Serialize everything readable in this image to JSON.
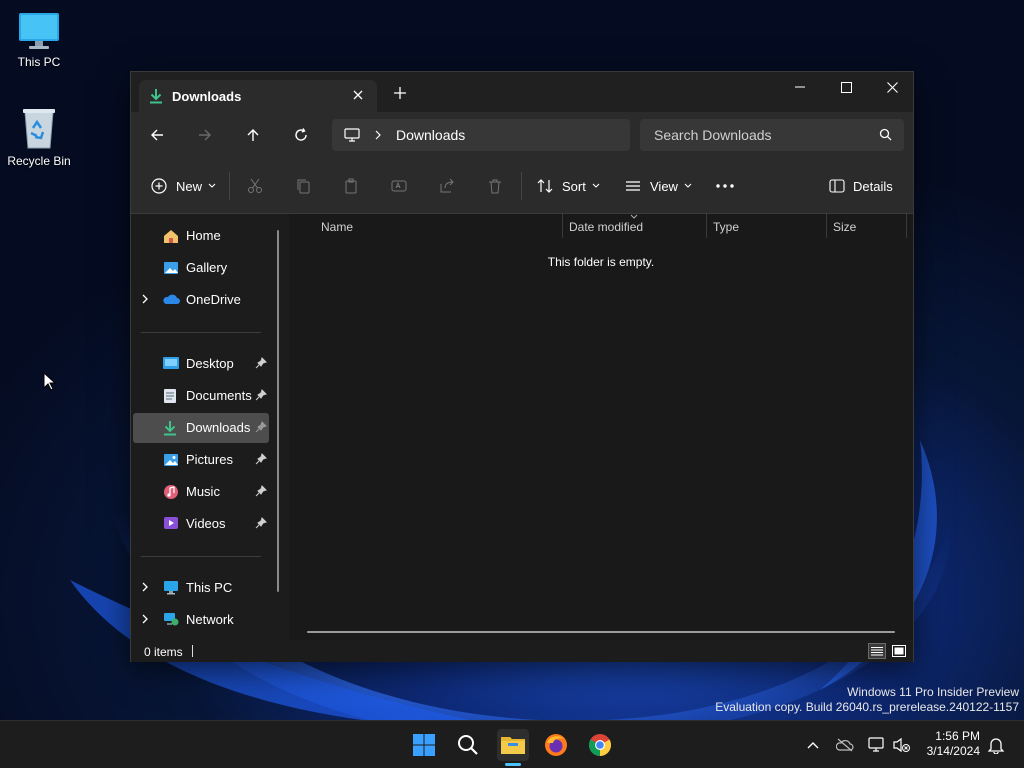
{
  "desktop": {
    "icons": [
      {
        "label": "This PC"
      },
      {
        "label": "Recycle Bin"
      }
    ]
  },
  "explorer": {
    "tab_title": "Downloads",
    "address": {
      "location": "Downloads"
    },
    "search": {
      "placeholder": "Search Downloads"
    },
    "toolbar": {
      "new_label": "New",
      "sort_label": "Sort",
      "view_label": "View",
      "details_label": "Details"
    },
    "nav": {
      "quick": [
        {
          "label": "Home"
        },
        {
          "label": "Gallery"
        },
        {
          "label": "OneDrive"
        }
      ],
      "pinned": [
        {
          "label": "Desktop"
        },
        {
          "label": "Documents"
        },
        {
          "label": "Downloads"
        },
        {
          "label": "Pictures"
        },
        {
          "label": "Music"
        },
        {
          "label": "Videos"
        }
      ],
      "devices": [
        {
          "label": "This PC"
        },
        {
          "label": "Network"
        }
      ],
      "selected": "Downloads"
    },
    "columns": [
      "Name",
      "Date modified",
      "Type",
      "Size"
    ],
    "empty_message": "This folder is empty.",
    "status": {
      "items": "0 items"
    }
  },
  "watermark": {
    "line1": "Windows 11 Pro Insider Preview",
    "line2": "Evaluation copy. Build 26040.rs_prerelease.240122-1157"
  },
  "taskbar": {
    "clock": {
      "time": "1:56 PM",
      "date": "3/14/2024"
    }
  },
  "colors": {
    "accent": "#4cc2ff",
    "download_green": "#3fc28b",
    "window_bg": "#1c1c1c"
  }
}
